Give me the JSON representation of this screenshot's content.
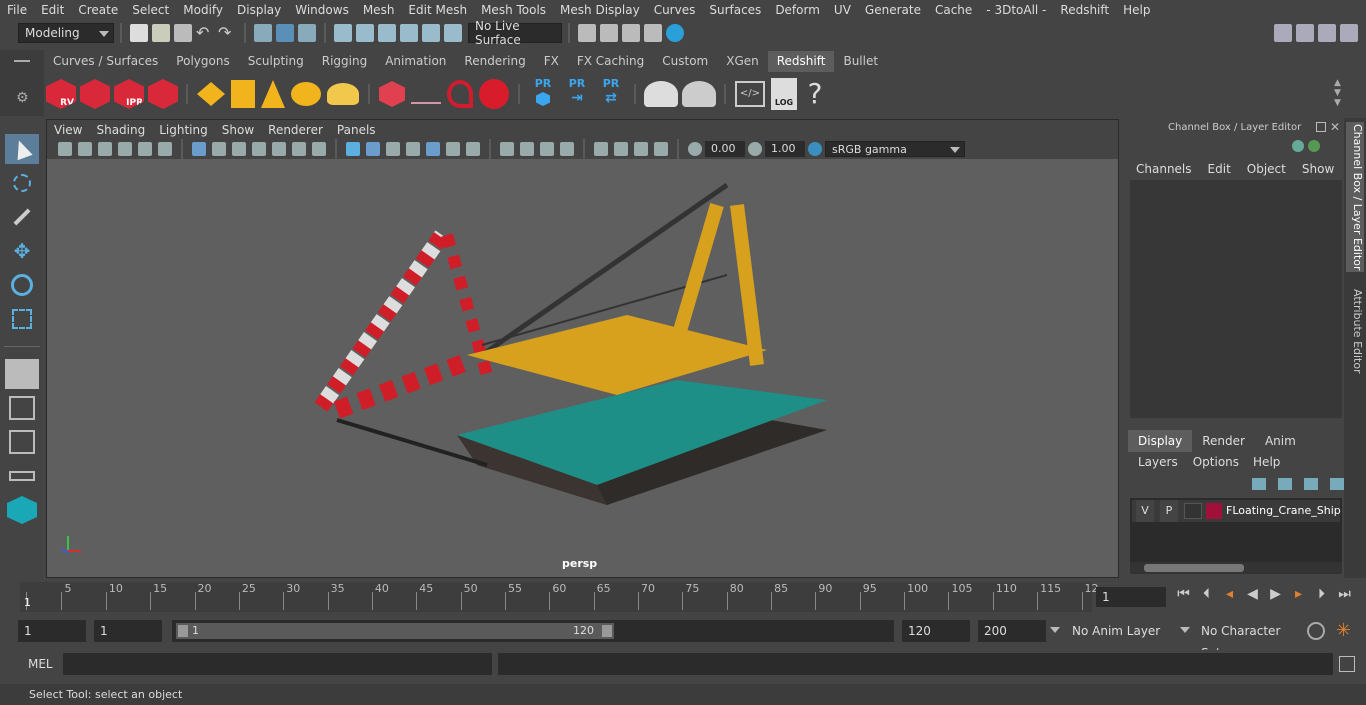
{
  "menus": [
    "File",
    "Edit",
    "Create",
    "Select",
    "Modify",
    "Display",
    "Windows",
    "Mesh",
    "Edit Mesh",
    "Mesh Tools",
    "Mesh Display",
    "Curves",
    "Surfaces",
    "Deform",
    "UV",
    "Generate",
    "Cache",
    "- 3DtoAll -",
    "Redshift",
    "Help"
  ],
  "mode_selector": "Modeling",
  "live_surface": "No Live Surface",
  "shelf_tabs": [
    "Curves / Surfaces",
    "Polygons",
    "Sculpting",
    "Rigging",
    "Animation",
    "Rendering",
    "FX",
    "FX Caching",
    "Custom",
    "XGen",
    "Redshift",
    "Bullet"
  ],
  "active_shelf_tab": "Redshift",
  "shelf_labels": {
    "rv": "RV",
    "ipr": "IPR",
    "pr1": "PR",
    "pr2": "PR",
    "pr3": "PR",
    "log": "LOG",
    "help": "?"
  },
  "viewport": {
    "menus": [
      "View",
      "Shading",
      "Lighting",
      "Show",
      "Renderer",
      "Panels"
    ],
    "exposure": "0.00",
    "gamma": "1.00",
    "color_space": "sRGB gamma",
    "camera_label": "persp"
  },
  "channel_box": {
    "title": "Channel Box / Layer Editor",
    "menus": [
      "Channels",
      "Edit",
      "Object",
      "Show"
    ]
  },
  "layer_editor": {
    "tabs": [
      "Display",
      "Render",
      "Anim"
    ],
    "active_tab": "Display",
    "menus": [
      "Layers",
      "Options",
      "Help"
    ],
    "layer": {
      "v": "V",
      "p": "P",
      "name": "FLoating_Crane_Ship",
      "color": "#a0103a"
    }
  },
  "side_tabs": [
    "Channel Box / Layer Editor",
    "Attribute Editor"
  ],
  "timeline": {
    "ticks": [
      "5",
      "10",
      "15",
      "20",
      "25",
      "30",
      "35",
      "40",
      "45",
      "50",
      "55",
      "60",
      "65",
      "70",
      "75",
      "80",
      "85",
      "90",
      "95",
      "100",
      "105",
      "110",
      "115",
      "12"
    ],
    "current_frame_marker": "1",
    "current_frame": "1"
  },
  "range": {
    "start": "1",
    "playback_start": "1",
    "slider_start": "1",
    "slider_end": "120",
    "playback_end": "120",
    "end": "200",
    "anim_layer": "No Anim Layer",
    "character_set": "No Character Set"
  },
  "command_line": {
    "label": "MEL"
  },
  "help_line": "Select Tool: select an object"
}
